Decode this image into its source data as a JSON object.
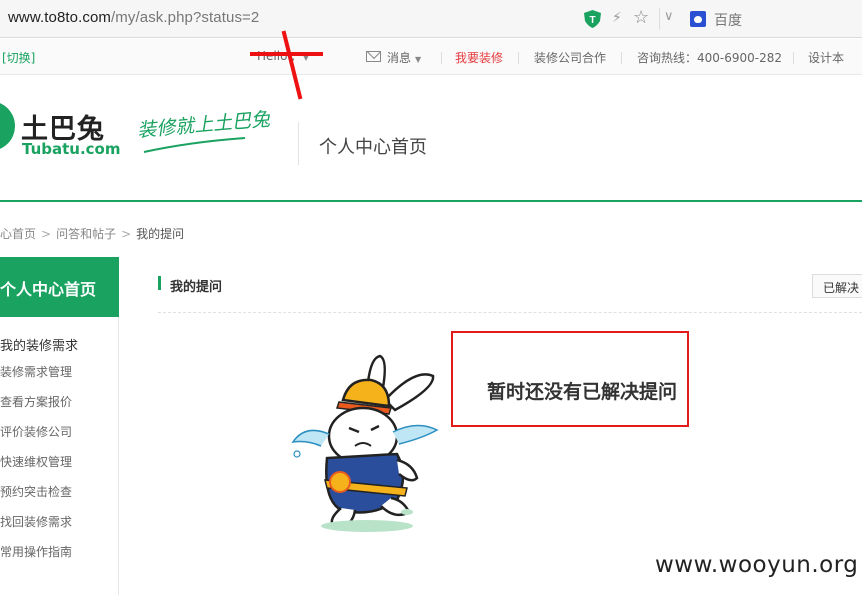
{
  "browser": {
    "url_host": "www.to8to.com",
    "url_path": "/my/ask.php?status=2",
    "search_engine": "百度"
  },
  "topnav": {
    "switch_label": "[切换]",
    "greeting": "Hello , ",
    "messages": "消息",
    "renovate": "我要装修",
    "cooperate": "装修公司合作",
    "hotline": "咨询热线：400-6900-282",
    "designer": "设计本"
  },
  "header": {
    "logo_cn": "土巴兔",
    "logo_en": "Tubatu.com",
    "slogan": "装修就上土巴兔",
    "title": "个人中心首页"
  },
  "breadcrumb": {
    "items": [
      "心首页",
      "问答和帖子",
      "我的提问"
    ]
  },
  "sidebar": {
    "head": "个人中心首页",
    "section": "我的装修需求",
    "items": [
      "装修需求管理",
      "查看方案报价",
      "评价装修公司",
      "快速维权管理",
      "预约突击检查",
      "找回装修需求",
      "常用操作指南"
    ]
  },
  "main": {
    "title": "我的提问",
    "tab_resolved": "已解决",
    "empty_message": "暂时还没有已解决提问"
  },
  "watermark": "www.wooyun.org",
  "colors": {
    "brand_green": "#1aa260",
    "annotation_red": "#e31b1b"
  }
}
